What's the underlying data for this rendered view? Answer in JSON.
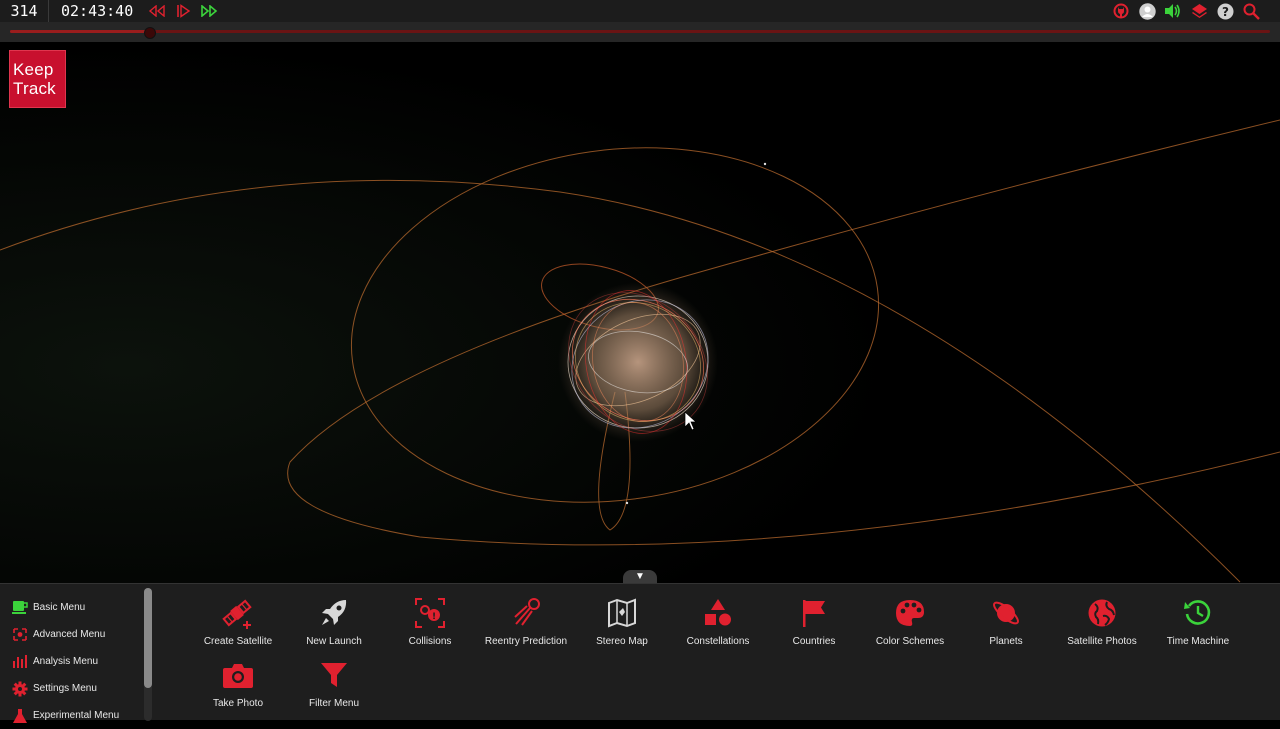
{
  "topbar": {
    "day_of_year": "314",
    "time": "02:43:40",
    "colors": {
      "rewind": "#e0212f",
      "play": "#e0212f",
      "fast_forward": "#3bd33b"
    },
    "right_icons": [
      "github-icon",
      "user-icon",
      "sound-icon",
      "layers-icon",
      "help-icon",
      "search-icon"
    ]
  },
  "timeline": {
    "progress_fraction": 0.11
  },
  "logo": {
    "line1": "Keep",
    "line2": "Track"
  },
  "drawer": {
    "toggle_glyph": "▼"
  },
  "side_menu": {
    "items": [
      {
        "label": "Basic Menu",
        "icon": "cup-icon",
        "color": "#3bd33b"
      },
      {
        "label": "Advanced Menu",
        "icon": "advanced-icon",
        "color": "#e0212f"
      },
      {
        "label": "Analysis Menu",
        "icon": "bar-chart-icon",
        "color": "#e0212f"
      },
      {
        "label": "Settings Menu",
        "icon": "gear-icon",
        "color": "#e0212f"
      },
      {
        "label": "Experimental Menu",
        "icon": "flask-icon",
        "color": "#e0212f"
      }
    ]
  },
  "tools": [
    {
      "label": "Create Satellite",
      "icon": "satellite-plus-icon",
      "color": "#e0212f"
    },
    {
      "label": "New Launch",
      "icon": "rocket-icon",
      "color": "#d8d8d8"
    },
    {
      "label": "Collisions",
      "icon": "collision-icon",
      "color": "#e0212f"
    },
    {
      "label": "Reentry Prediction",
      "icon": "reentry-icon",
      "color": "#e0212f"
    },
    {
      "label": "Stereo Map",
      "icon": "map-icon",
      "color": "#d8d8d8"
    },
    {
      "label": "Constellations",
      "icon": "shapes-icon",
      "color": "#e0212f"
    },
    {
      "label": "Countries",
      "icon": "flag-icon",
      "color": "#e0212f"
    },
    {
      "label": "Color Schemes",
      "icon": "palette-icon",
      "color": "#e0212f"
    },
    {
      "label": "Planets",
      "icon": "planet-icon",
      "color": "#e0212f"
    },
    {
      "label": "Satellite Photos",
      "icon": "globe-icon",
      "color": "#e0212f"
    },
    {
      "label": "Time Machine",
      "icon": "history-icon",
      "color": "#3bd33b"
    },
    {
      "label": "Take Photo",
      "icon": "camera-icon",
      "color": "#e0212f"
    },
    {
      "label": "Filter Menu",
      "icon": "filter-icon",
      "color": "#e0212f"
    }
  ]
}
